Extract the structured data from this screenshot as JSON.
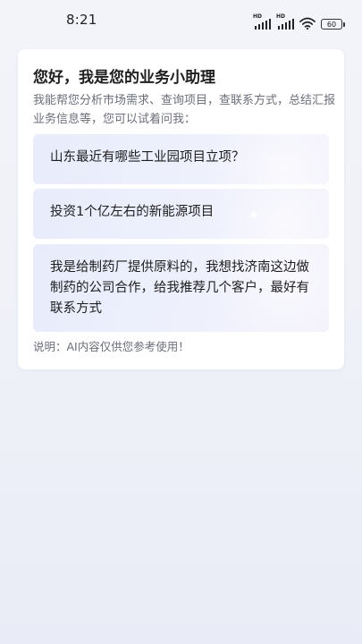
{
  "status_bar": {
    "time": "8:21",
    "signal_1_label": "HD",
    "signal_2_label": "HD",
    "battery_level": "60",
    "icons": [
      "signal-hd-icon",
      "signal-hd-icon",
      "wifi-icon",
      "battery-icon"
    ]
  },
  "assistant": {
    "title": "您好，我是您的业务小助理",
    "description": "我能帮您分析市场需求、查询项目，查联系方式，总结汇报业务信息等，您可以试着问我：",
    "suggestions": [
      {
        "text": "山东最近有哪些工业园项目立项？"
      },
      {
        "text": "投资1个亿左右的新能源项目"
      },
      {
        "text": "我是给制药厂提供原料的，我想找济南这边做制药的公司合作，给我推荐几个客户，最好有联系方式"
      }
    ],
    "note": "说明：AI内容仅供您参考使用！"
  },
  "colors": {
    "background": "#f1f2f8",
    "card": "#ffffff",
    "suggestion_bg": "#e8ecfb",
    "title_text": "#1f1f1f",
    "secondary_text": "#6b6f7a"
  }
}
